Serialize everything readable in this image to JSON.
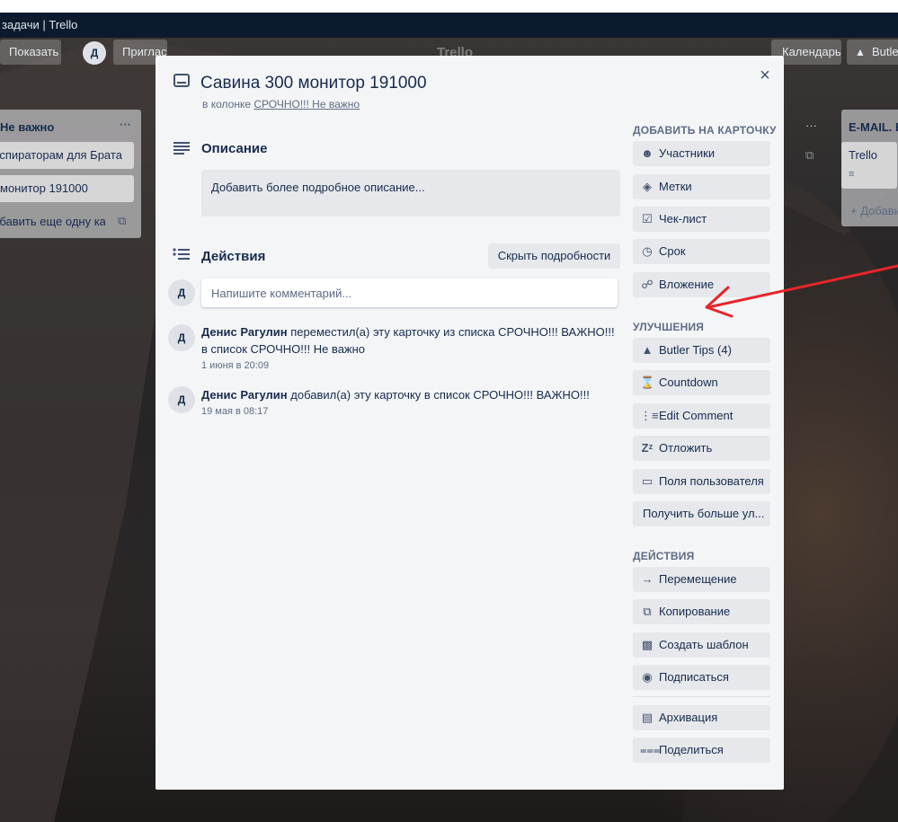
{
  "window": {
    "title": "задачи | Trello"
  },
  "board": {
    "logo_text": "Trello",
    "header_left_text": "Показать",
    "invite_label": "Пригласить",
    "member_initial": "Д",
    "calendar_label": "Календарь",
    "butler_label": "Butler",
    "left_list": {
      "title": "Не важно",
      "menu": "···",
      "cards": [
        "Респираторам для Брата",
        "монитор 191000"
      ],
      "add_card": "+ Добавить еще одну карточку"
    },
    "right_list": {
      "title": "E-MAIL. B",
      "menu": "···",
      "cards": [
        "Trello"
      ],
      "add_card": "+ Добавить"
    }
  },
  "card": {
    "title": "Савина 300 монитор 191000",
    "list_prefix": "в колонке",
    "list_name": "СРОЧНО!!! Не важно",
    "close_icon": "×",
    "description": {
      "title": "Описание",
      "placeholder": "Добавить более подробное описание..."
    },
    "activity": {
      "title": "Действия",
      "hide_details": "Скрыть подробности",
      "comment_placeholder": "Напишите комментарий...",
      "current_user_initial": "Д",
      "items": [
        {
          "initial": "Д",
          "author": "Денис Рагулин",
          "text": "переместил(а) эту карточку из списка СРОЧНО!!! ВАЖНО!!! в список СРОЧНО!!! Не важно",
          "time": "1 июня в 20:09"
        },
        {
          "initial": "Д",
          "author": "Денис Рагулин",
          "text": "добавил(а) эту карточку в список СРОЧНО!!! ВАЖНО!!!",
          "time": "19 мая в 08:17"
        }
      ]
    }
  },
  "sidebar": {
    "add_to_card": {
      "title": "ДОБАВИТЬ НА КАРТОЧКУ",
      "items": [
        {
          "label": "Участники",
          "icon": "person-icon"
        },
        {
          "label": "Метки",
          "icon": "tag-icon"
        },
        {
          "label": "Чек-лист",
          "icon": "checkbox-icon"
        },
        {
          "label": "Срок",
          "icon": "clock-icon"
        },
        {
          "label": "Вложение",
          "icon": "paperclip-icon"
        }
      ]
    },
    "power_ups": {
      "title": "УЛУЧШЕНИЯ",
      "items": [
        {
          "label": "Butler Tips (4)",
          "icon": "butler-icon"
        },
        {
          "label": "Countdown",
          "icon": "hourglass-icon"
        },
        {
          "label": "Edit Comment",
          "icon": "edit-comment-icon"
        },
        {
          "label": "Отложить",
          "icon": "snooze-icon"
        },
        {
          "label": "Поля пользователя",
          "icon": "custom-fields-icon"
        }
      ],
      "get_more": "Получить больше ул..."
    },
    "actions": {
      "title": "ДЕЙСТВИЯ",
      "items": [
        {
          "label": "Перемещение",
          "icon": "arrow-right-icon"
        },
        {
          "label": "Копирование",
          "icon": "copy-icon"
        },
        {
          "label": "Создать шаблон",
          "icon": "template-icon"
        },
        {
          "label": "Подписаться",
          "icon": "eye-icon"
        },
        {
          "label": "Архивация",
          "icon": "archive-icon"
        },
        {
          "label": "Поделиться",
          "icon": "share-icon"
        }
      ]
    }
  },
  "colors": {
    "modal_bg": "#f4f5f7",
    "button_bg": "#e6e8ec",
    "text": "#172b4d",
    "muted": "#5e6c84",
    "annotation_arrow": "#e8252a"
  }
}
